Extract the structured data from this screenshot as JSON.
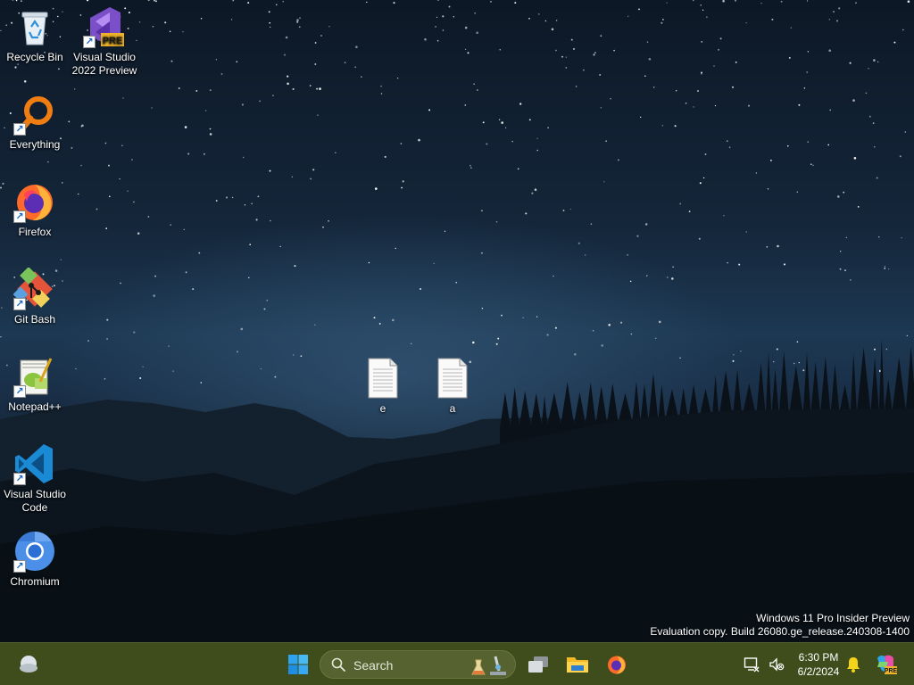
{
  "desktop_icons": [
    {
      "label": "Recycle Bin",
      "icon": "recycle-bin-icon",
      "shortcut": false
    },
    {
      "label": "Visual Studio 2022 Preview",
      "icon": "visual-studio-preview-icon",
      "shortcut": true,
      "badge": "PRE"
    },
    {
      "label": "Everything",
      "icon": "everything-search-icon",
      "shortcut": true
    },
    {
      "label": "Firefox",
      "icon": "firefox-icon",
      "shortcut": true
    },
    {
      "label": "Git Bash",
      "icon": "git-bash-icon",
      "shortcut": true
    },
    {
      "label": "Notepad++",
      "icon": "notepad-plus-plus-icon",
      "shortcut": true
    },
    {
      "label": "Visual Studio Code",
      "icon": "vscode-icon",
      "shortcut": true
    },
    {
      "label": "Chromium",
      "icon": "chromium-icon",
      "shortcut": true
    },
    {
      "label": "e",
      "icon": "text-file-icon",
      "shortcut": false
    },
    {
      "label": "a",
      "icon": "text-file-icon",
      "shortcut": false
    }
  ],
  "watermark": {
    "line1": "Windows 11 Pro Insider Preview",
    "line2": "Evaluation copy. Build 26080.ge_release.240308-1400"
  },
  "taskbar": {
    "search_placeholder": "Search",
    "clock_time": "6:30 PM",
    "clock_date": "6/2/2024",
    "colors": {
      "background": "#3f4d1c",
      "search_bg": "#56622f"
    }
  }
}
